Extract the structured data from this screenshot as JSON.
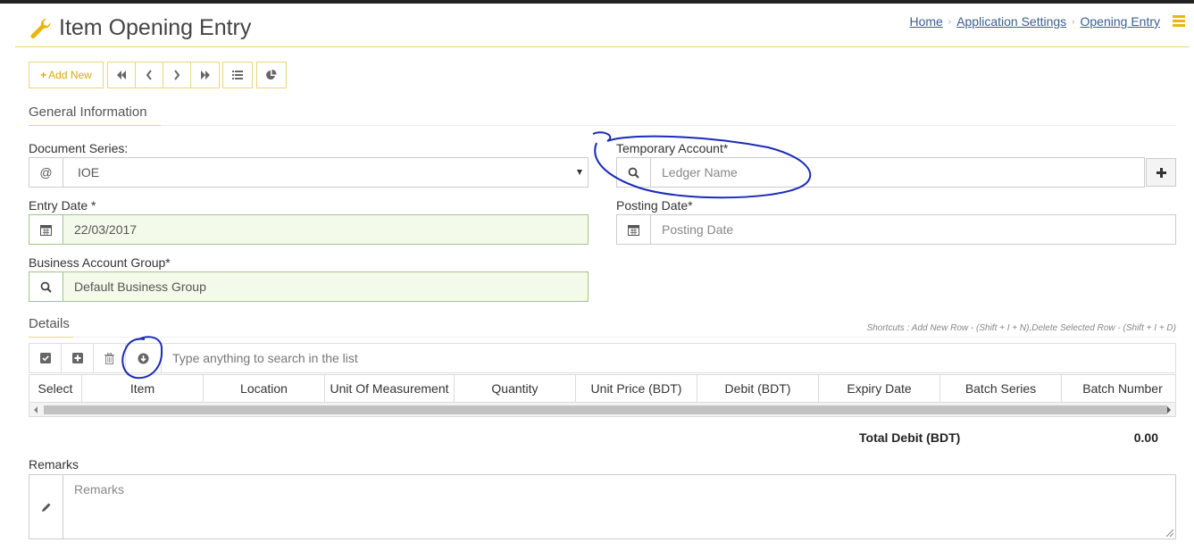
{
  "header": {
    "title": "Item Opening Entry",
    "breadcrumb": [
      "Home",
      "Application Settings",
      "Opening Entry"
    ]
  },
  "toolbar": {
    "add_new_label": "Add New"
  },
  "general": {
    "title": "General Information",
    "document_series": {
      "label": "Document Series:",
      "value": "IOE"
    },
    "temporary_account": {
      "label": "Temporary Account*",
      "placeholder": "Ledger Name"
    },
    "entry_date": {
      "label": "Entry Date *",
      "value": "22/03/2017"
    },
    "posting_date": {
      "label": "Posting Date*",
      "placeholder": "Posting Date"
    },
    "business_group": {
      "label": "Business Account Group*",
      "value": "Default Business Group"
    }
  },
  "details": {
    "title": "Details",
    "shortcuts": "Shortcuts : Add New Row - (Shift + I + N),Delete Selected Row - (Shift + I + D)",
    "search_placeholder": "Type anything to search in the list",
    "columns": [
      "Select",
      "Item",
      "Location",
      "Unit Of Measurement",
      "Quantity",
      "Unit Price (BDT)",
      "Debit (BDT)",
      "Expiry Date",
      "Batch Series",
      "Batch Number"
    ]
  },
  "totals": {
    "label": "Total Debit (BDT)",
    "value": "0.00"
  },
  "remarks": {
    "label": "Remarks",
    "placeholder": "Remarks"
  },
  "colors": {
    "accent": "#d4ac0d",
    "border_accent": "#e8d77a",
    "valid_bg": "#f4faea",
    "annotation": "#1a2bb8"
  }
}
